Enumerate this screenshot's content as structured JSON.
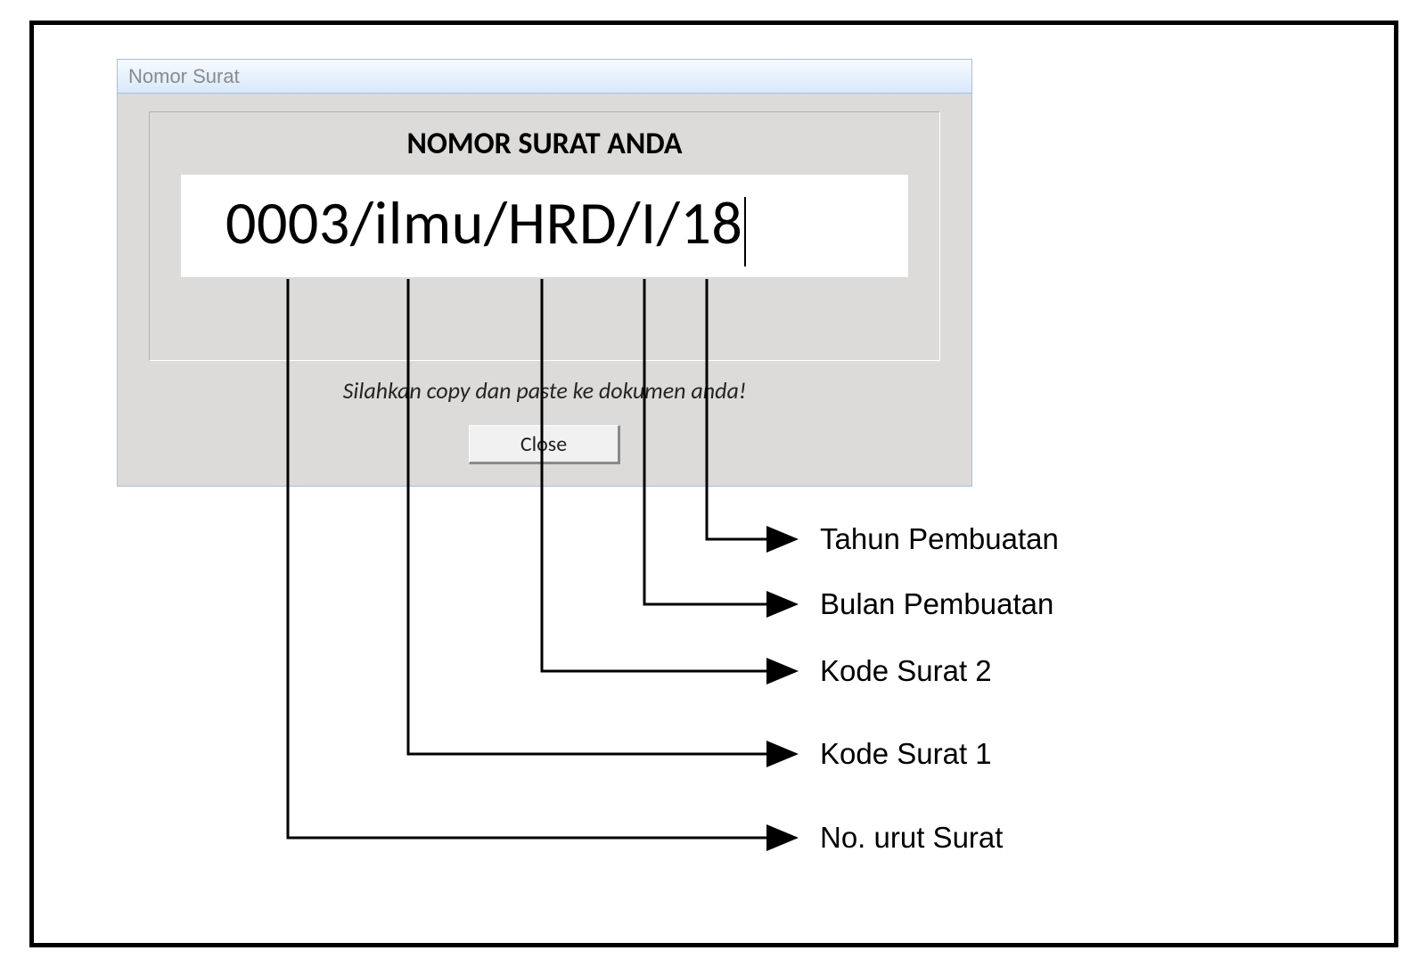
{
  "dialog": {
    "window_title": "Nomor Surat",
    "heading": "NOMOR SURAT ANDA",
    "number_value": "0003/ilmu/HRD/I/18",
    "instruction": "Silahkan copy dan paste ke dokumen anda!",
    "close_label": "Close"
  },
  "annotations": {
    "tahun": "Tahun Pembuatan",
    "bulan": "Bulan Pembuatan",
    "kode2": "Kode Surat 2",
    "kode1": "Kode Surat 1",
    "nourut": "No. urut Surat"
  }
}
